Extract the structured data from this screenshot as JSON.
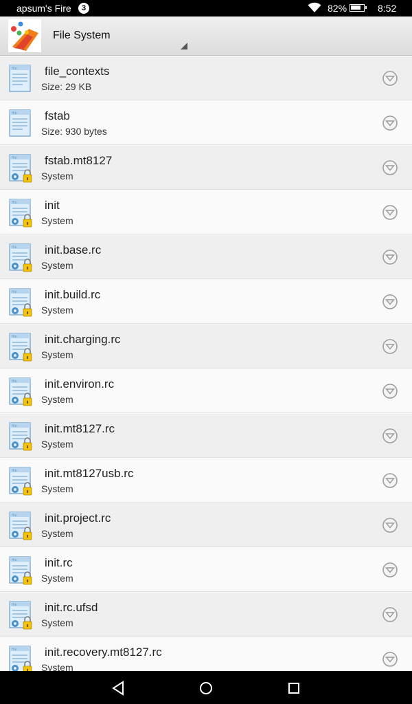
{
  "status_bar": {
    "owner": "apsum's Fire",
    "notification_count": "3",
    "battery": "82%",
    "time": "8:52"
  },
  "app_bar": {
    "title": "File System"
  },
  "files": [
    {
      "name": "file_contexts",
      "detail": "Size: 29 KB",
      "icon": "file-icon"
    },
    {
      "name": "fstab",
      "detail": "Size: 930 bytes",
      "icon": "file-icon"
    },
    {
      "name": "fstab.mt8127",
      "detail": "System",
      "icon": "system-file-icon"
    },
    {
      "name": "init",
      "detail": "System",
      "icon": "system-file-icon"
    },
    {
      "name": "init.base.rc",
      "detail": "System",
      "icon": "system-file-icon"
    },
    {
      "name": "init.build.rc",
      "detail": "System",
      "icon": "system-file-icon"
    },
    {
      "name": "init.charging.rc",
      "detail": "System",
      "icon": "system-file-icon"
    },
    {
      "name": "init.environ.rc",
      "detail": "System",
      "icon": "system-file-icon"
    },
    {
      "name": "init.mt8127.rc",
      "detail": "System",
      "icon": "system-file-icon"
    },
    {
      "name": "init.mt8127usb.rc",
      "detail": "System",
      "icon": "system-file-icon"
    },
    {
      "name": "init.project.rc",
      "detail": "System",
      "icon": "system-file-icon"
    },
    {
      "name": "init.rc",
      "detail": "System",
      "icon": "system-file-icon"
    },
    {
      "name": "init.rc.ufsd",
      "detail": "System",
      "icon": "system-file-icon"
    },
    {
      "name": "init.recovery.mt8127.rc",
      "detail": "System",
      "icon": "system-file-icon"
    }
  ],
  "icons": {
    "file_icon_label": "file"
  },
  "nav_bar": {
    "back": "back-icon",
    "home": "home-icon",
    "recents": "recents-icon"
  }
}
